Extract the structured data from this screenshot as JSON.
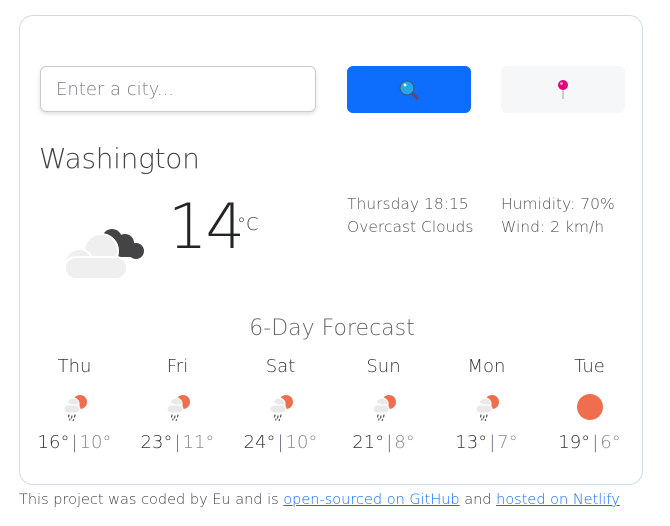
{
  "search": {
    "placeholder": "Enter a city...",
    "value": "",
    "search_icon": "magnifying-glass-icon",
    "location_icon": "pushpin-icon"
  },
  "current": {
    "city": "Washington",
    "temperature": "14",
    "unit": "°C",
    "datetime": "Thursday 18:15",
    "description": "Overcast Clouds",
    "humidity": "Humidity: 70%",
    "wind": "Wind: 2 km/h",
    "icon": "overcast-clouds-icon"
  },
  "forecast": {
    "title": "6-Day Forecast",
    "days": [
      {
        "name": "Thu",
        "max": "16°",
        "min": "10°",
        "icon": "rain-sun-icon"
      },
      {
        "name": "Fri",
        "max": "23°",
        "min": "11°",
        "icon": "rain-sun-icon"
      },
      {
        "name": "Sat",
        "max": "24°",
        "min": "10°",
        "icon": "rain-sun-icon"
      },
      {
        "name": "Sun",
        "max": "21°",
        "min": "8°",
        "icon": "rain-sun-icon"
      },
      {
        "name": "Mon",
        "max": "13°",
        "min": "7°",
        "icon": "rain-sun-icon"
      },
      {
        "name": "Tue",
        "max": "19°",
        "min": "6°",
        "icon": "sun-icon"
      }
    ],
    "separator": "|"
  },
  "footer": {
    "text_1": "This project was coded by Eu and is ",
    "link_1": "open-sourced on GitHub",
    "text_2": " and ",
    "link_2": "hosted on Netlify"
  },
  "colors": {
    "primary": "#0d6efd",
    "sun": "#ee6e4d",
    "pin": "#e6007e"
  }
}
